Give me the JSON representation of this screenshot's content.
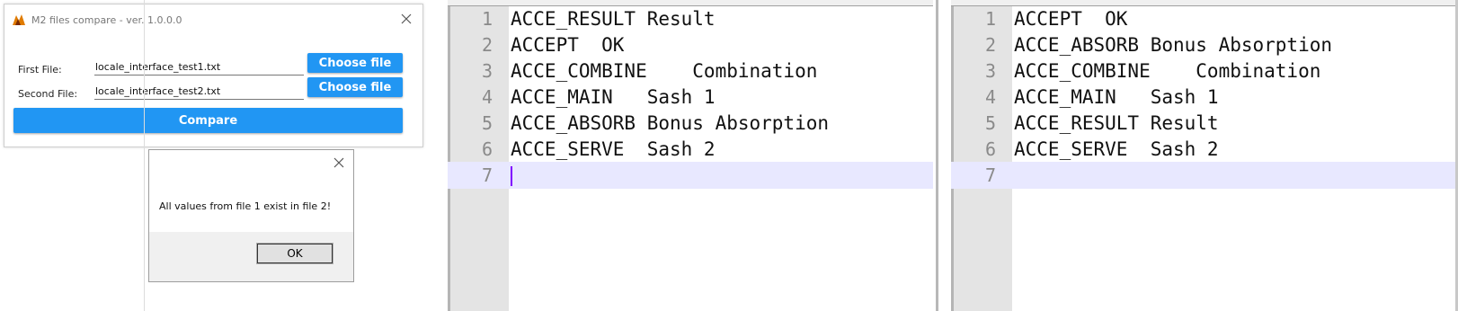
{
  "app": {
    "title": "M2 files compare - ver. 1.0.0.0",
    "first_label": "First File:",
    "first_value": "locale_interface_test1.txt",
    "second_label": "Second File:",
    "second_value": "locale_interface_test2.txt",
    "choose_label": "Choose file",
    "compare_label": "Compare",
    "accent": "#2196f3"
  },
  "message": {
    "text": "All values from file 1 exist in file 2!",
    "ok_label": "OK"
  },
  "editor_left": {
    "current_line": 7,
    "lines": [
      {
        "num": "1",
        "text": "ACCE_RESULT Result"
      },
      {
        "num": "2",
        "text": "ACCEPT  OK"
      },
      {
        "num": "3",
        "text": "ACCE_COMBINE    Combination"
      },
      {
        "num": "4",
        "text": "ACCE_MAIN   Sash 1"
      },
      {
        "num": "5",
        "text": "ACCE_ABSORB Bonus Absorption"
      },
      {
        "num": "6",
        "text": "ACCE_SERVE  Sash 2"
      },
      {
        "num": "7",
        "text": ""
      }
    ]
  },
  "editor_right": {
    "current_line": 7,
    "lines": [
      {
        "num": "1",
        "text": "ACCEPT  OK"
      },
      {
        "num": "2",
        "text": "ACCE_ABSORB Bonus Absorption"
      },
      {
        "num": "3",
        "text": "ACCE_COMBINE    Combination"
      },
      {
        "num": "4",
        "text": "ACCE_MAIN   Sash 1"
      },
      {
        "num": "5",
        "text": "ACCE_RESULT Result"
      },
      {
        "num": "6",
        "text": "ACCE_SERVE  Sash 2"
      },
      {
        "num": "7",
        "text": ""
      }
    ]
  }
}
